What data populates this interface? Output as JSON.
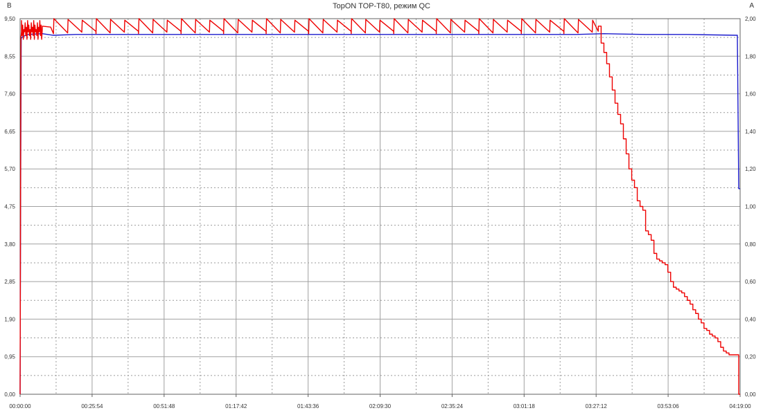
{
  "chart_data": {
    "type": "line",
    "title": "TopON TOP-T80, режим QC",
    "left_axis_label": "В",
    "right_axis_label": "А",
    "grid": true,
    "x_ticks": [
      "00:00:00",
      "00:25:54",
      "00:51:48",
      "01:17:42",
      "01:43:36",
      "02:09:30",
      "02:35:24",
      "03:01:18",
      "03:27:12",
      "03:53:06",
      "04:19:00"
    ],
    "x_range_minutes": [
      0,
      259
    ],
    "left_ticks": [
      "0,00",
      "0,95",
      "1,90",
      "2,85",
      "3,80",
      "4,75",
      "5,70",
      "6,65",
      "7,60",
      "8,55",
      "9,50"
    ],
    "left_range": [
      0,
      9.5
    ],
    "right_ticks": [
      "0,00",
      "0,20",
      "0,40",
      "0,60",
      "0,80",
      "1,00",
      "1,20",
      "1,40",
      "1,60",
      "1,80",
      "2,00"
    ],
    "right_range": [
      0,
      2.0
    ],
    "series": [
      {
        "axis": "left",
        "color": "#1a1acc",
        "x": [
          0,
          0.2,
          0.4,
          1,
          3,
          8,
          12,
          20,
          80,
          200,
          210,
          225,
          240,
          258,
          258.5,
          259
        ],
        "y": [
          0,
          5.2,
          9.0,
          9.05,
          9.1,
          9.12,
          9.08,
          9.1,
          9.1,
          9.1,
          9.12,
          9.1,
          9.1,
          9.08,
          5.2,
          5.2
        ]
      },
      {
        "axis": "right",
        "color": "#ee0000",
        "sawtooth": {
          "start": 12,
          "end": 208,
          "period": 5.1,
          "high": 2.0,
          "low": 1.92
        },
        "noise": {
          "start": 0.5,
          "end": 8,
          "high": 1.99,
          "low": 1.89
        },
        "x": [
          0,
          0.3,
          0.5,
          208,
          209,
          210,
          211,
          212,
          213,
          214,
          215,
          216,
          217,
          218,
          219,
          220,
          221,
          222,
          223,
          224,
          225,
          226,
          227,
          228,
          229,
          230,
          231,
          232,
          233,
          234,
          235,
          236,
          237,
          238,
          239,
          240,
          241,
          242,
          243,
          244,
          245,
          246,
          247,
          248,
          249,
          250,
          251,
          252,
          253,
          254,
          255,
          256,
          257,
          258,
          258.5,
          259
        ],
        "y": [
          0,
          1.9,
          1.93,
          1.96,
          1.87,
          1.82,
          1.76,
          1.69,
          1.62,
          1.55,
          1.49,
          1.44,
          1.36,
          1.28,
          1.2,
          1.14,
          1.1,
          1.03,
          1.0,
          0.98,
          0.87,
          0.85,
          0.82,
          0.75,
          0.72,
          0.71,
          0.7,
          0.69,
          0.65,
          0.6,
          0.57,
          0.56,
          0.55,
          0.54,
          0.52,
          0.5,
          0.48,
          0.45,
          0.43,
          0.4,
          0.38,
          0.35,
          0.34,
          0.32,
          0.31,
          0.3,
          0.28,
          0.25,
          0.23,
          0.22,
          0.21,
          0.21,
          0.21,
          0.21,
          0.0,
          0.0
        ]
      }
    ]
  }
}
